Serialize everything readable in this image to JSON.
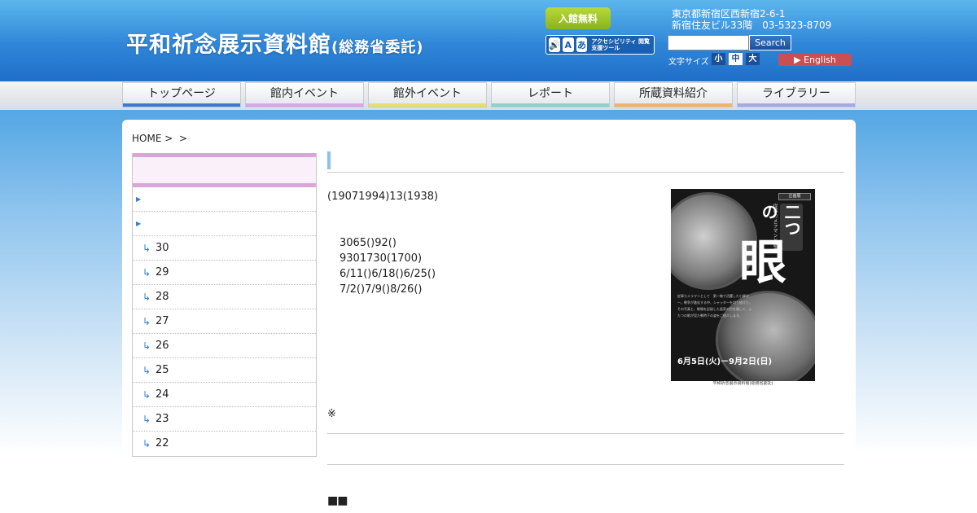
{
  "header": {
    "logo_main": "平和祈念展示資料館",
    "logo_sub": "(総務省委託)",
    "free_badge": "入館無料",
    "accessibility_label": "アクセシビリティ 閲覧支援ツール",
    "address": "東京都新宿区西新宿2-6-1\n新宿住友ビル33階　03-5323-8709",
    "search": {
      "value": "",
      "button": "Search"
    },
    "font_size": {
      "label": "文字サイズ",
      "small": "小",
      "medium": "中",
      "large": "大",
      "selected": "中"
    },
    "english": "English"
  },
  "nav": {
    "items": [
      {
        "label": "トップページ",
        "color": "#3a7bd0"
      },
      {
        "label": "館内イベント",
        "color": "#d9a6e6"
      },
      {
        "label": "館外イベント",
        "color": "#e6e068"
      },
      {
        "label": "レポート",
        "color": "#8ad4c6"
      },
      {
        "label": "所蔵資料紹介",
        "color": "#f0b36a"
      },
      {
        "label": "ライブラリー",
        "color": "#a9a6e6"
      }
    ]
  },
  "breadcrumb": {
    "home": "HOME",
    "sep1": ">",
    "sep2": ">"
  },
  "sidebar": {
    "items": [
      {
        "label": "",
        "type": "top"
      },
      {
        "label": "",
        "type": "top"
      },
      {
        "label": "30",
        "type": "sub"
      },
      {
        "label": "29",
        "type": "sub"
      },
      {
        "label": "28",
        "type": "sub"
      },
      {
        "label": "27",
        "type": "sub"
      },
      {
        "label": "26",
        "type": "sub"
      },
      {
        "label": "25",
        "type": "sub"
      },
      {
        "label": "24",
        "type": "sub"
      },
      {
        "label": "23",
        "type": "sub"
      },
      {
        "label": "22",
        "type": "sub"
      }
    ]
  },
  "main": {
    "intro": "(19071994)13(1938)",
    "details": [
      "3065()92()",
      "9301730(1700)",
      "6/11()6/18()6/25()",
      "7/2()7/9()8/26()"
    ],
    "note": "※",
    "squares": "■■"
  },
  "poster": {
    "tag": "企画展",
    "title_two": "二つの",
    "title_eye": "眼",
    "vertical_caption": "従軍カメラマンと報道",
    "body": "従軍カメラマンとして　第一線で活躍した小柳次一。戦争が激化する中、シャッターを切り続けた。その写真と、戦場を記録した画家の目を通して、ふたつの眼が見た戦時下の姿をご紹介します。",
    "dates": "6月5日(火)－9月2日(日)",
    "footer": "平和祈念展示資料館(総務省委託)"
  }
}
